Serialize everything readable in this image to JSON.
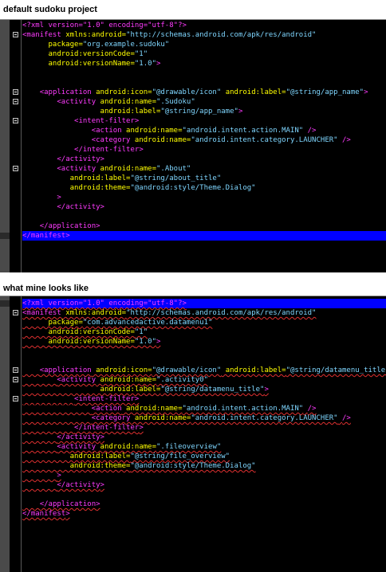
{
  "headings": {
    "top": "default sudoku project",
    "bottom": "what mine looks like"
  },
  "editor_top": {
    "lines": [
      [
        "<?xml version=\"1.0\" encoding=\"utf-8\"?>"
      ],
      [
        "<manifest xmlns:android=\"http://schemas.android.com/apk/res/android\""
      ],
      [
        "      package=\"org.example.sudoku\""
      ],
      [
        "      android:versionCode=\"1\""
      ],
      [
        "      android:versionName=\"1.0\">"
      ],
      [
        ""
      ],
      [
        ""
      ],
      [
        "    <application android:icon=\"@drawable/icon\" android:label=\"@string/app_name\">"
      ],
      [
        "        <activity android:name=\".Sudoku\""
      ],
      [
        "                  android:label=\"@string/app_name\">"
      ],
      [
        "            <intent-filter>"
      ],
      [
        "                <action android:name=\"android.intent.action.MAIN\" />"
      ],
      [
        "                <category android:name=\"android.intent.category.LAUNCHER\" />"
      ],
      [
        "            </intent-filter>"
      ],
      [
        "        </activity>"
      ],
      [
        "        <activity android:name=\".About\""
      ],
      [
        "           android:label=\"@string/about_title\""
      ],
      [
        "           android:theme=\"@android:style/Theme.Dialog\""
      ],
      [
        "        >"
      ],
      [
        "        </activity>"
      ],
      [
        ""
      ],
      [
        "    </application>"
      ],
      [
        "</manifest>"
      ]
    ]
  },
  "editor_bottom": {
    "lines": [
      [
        "<?xml version=\"1.0\" encoding=\"utf-8\"?>"
      ],
      [
        "<manifest xmlns:android=\"http://schemas.android.com/apk/res/android\""
      ],
      [
        "      package=\"com.advancedactive.datamenu1\""
      ],
      [
        "      android:versionCode=\"1\""
      ],
      [
        "      android:versionName=\"1.0\">"
      ],
      [
        ""
      ],
      [
        ""
      ],
      [
        "    <application android:icon=\"@drawable/icon\" android:label=\"@string/datamenu_title\">"
      ],
      [
        "        <activity android:name=\".activity0\""
      ],
      [
        "                  android:label=\"@string/datamenu_title\">"
      ],
      [
        "            <intent-filter>"
      ],
      [
        "                <action android:name=\"android.intent.action.MAIN\" />"
      ],
      [
        "                <category android:name=\"android.intent.category.LAUNCHER\" />"
      ],
      [
        "            </intent-filter>"
      ],
      [
        "        </activity>"
      ],
      [
        "        <activity android:name=\".fileoverview\""
      ],
      [
        "           android:label=\"@string/file_overview\""
      ],
      [
        "           android:theme=\"@android:style/Theme.Dialog\""
      ],
      [
        "        >"
      ],
      [
        "        </activity>"
      ],
      [
        ""
      ],
      [
        "    </application>"
      ],
      [
        "</manifest>"
      ]
    ]
  },
  "colors": {
    "tag": "#ffff00",
    "xml_decl": "#ff3bff",
    "value": "#7fd6ff",
    "selection": "#0000ff"
  }
}
